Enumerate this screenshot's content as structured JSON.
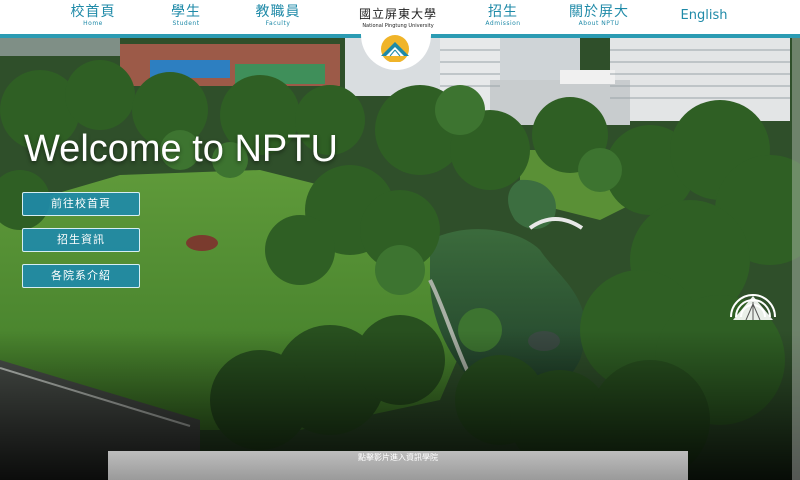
{
  "nav": {
    "items": [
      {
        "zh": "校首頁",
        "en": "Home"
      },
      {
        "zh": "學生",
        "en": "Student"
      },
      {
        "zh": "教職員",
        "en": "Faculty"
      },
      {
        "zh": "招生",
        "en": "Admission"
      },
      {
        "zh": "關於屏大",
        "en": "About NPTU"
      }
    ],
    "english_label": "English"
  },
  "logo": {
    "name_zh": "國立屏東大學",
    "name_en": "National Pingtung University"
  },
  "hero": {
    "welcome": "Welcome to NPTU",
    "buttons": [
      "前往校首頁",
      "招生資訊",
      "各院系介紹"
    ]
  },
  "video_bar": {
    "label": "點擊影片進入資訊學院"
  },
  "colors": {
    "accent": "#1f8aa8",
    "nav_border": "#2b9bb3",
    "button_bg": "#1f8aa8"
  },
  "icons": [
    "nptu-emblem-icon",
    "nptu-emblem-icon-white"
  ]
}
